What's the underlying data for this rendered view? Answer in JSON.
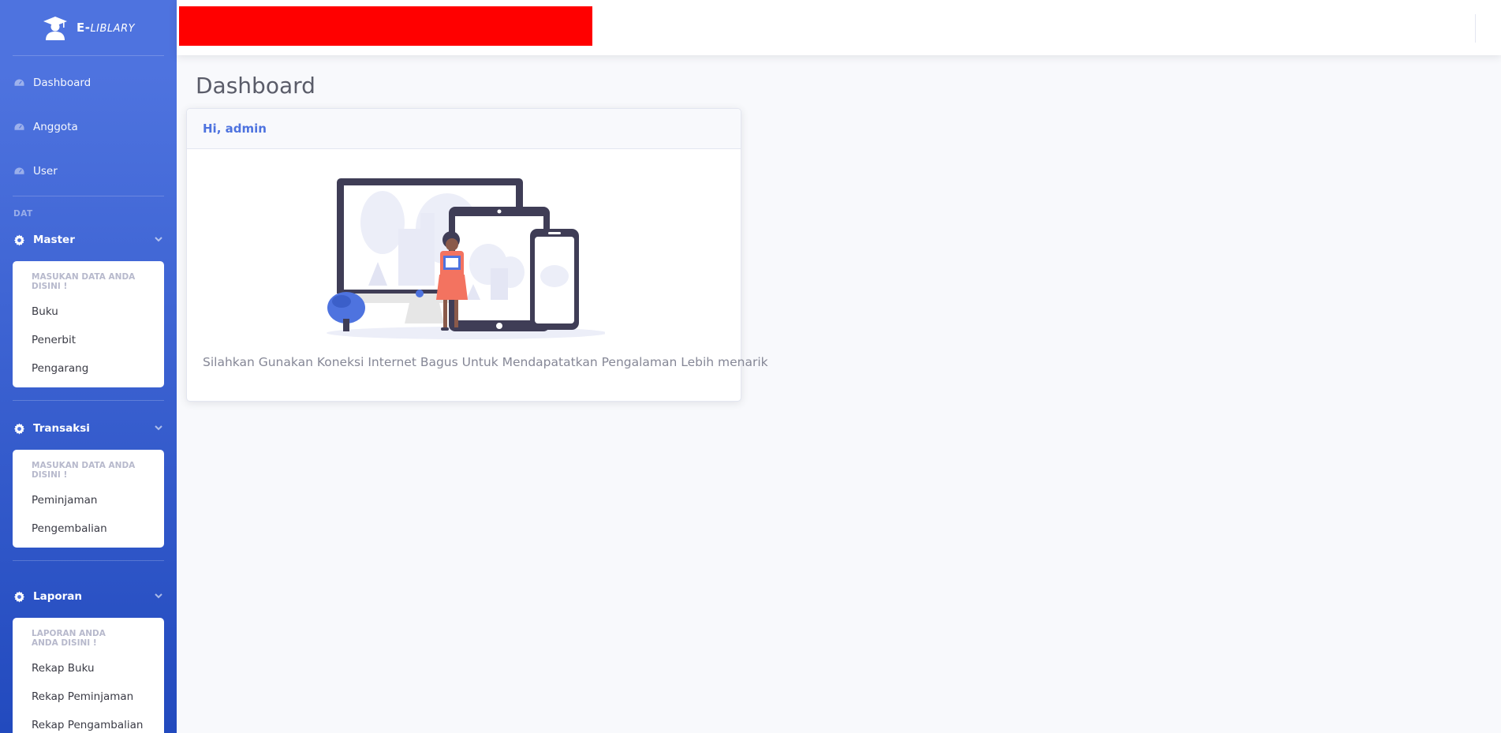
{
  "brand": {
    "prefix": "E-",
    "suffix": "LIBLARY"
  },
  "sidebar": {
    "nav": [
      {
        "label": "Dashboard",
        "icon": "tachometer-icon"
      },
      {
        "label": "Anggota",
        "icon": "tachometer-icon"
      },
      {
        "label": "User",
        "icon": "tachometer-icon"
      }
    ],
    "heading": "DAT",
    "groups": [
      {
        "label": "Master",
        "header": "MASUKAN DATA ANDA DISINI !",
        "items": [
          "Buku",
          "Penerbit",
          "Pengarang"
        ]
      },
      {
        "label": "Transaksi",
        "header": "MASUKAN DATA ANDA DISINI !",
        "items": [
          "Peminjaman",
          "Pengembalian"
        ]
      },
      {
        "label": "Laporan",
        "header_line1": "LAPORAN ANDA",
        "header_line2": "ANDA DISINI !",
        "items": [
          "Rekap Buku",
          "Rekap Peminjaman",
          "Rekap Pengambalian"
        ]
      }
    ]
  },
  "main": {
    "title": "Dashboard",
    "card": {
      "greeting": "Hi, admin",
      "message": "Silahkan Gunakan Koneksi Internet Bagus Untuk Mendapatatkan Pengalaman Lebih menarik"
    }
  },
  "colors": {
    "primary": "#4e73df",
    "sidebar_bottom": "#224abe",
    "redaction": "#ff0000",
    "illustration_coral": "#f37360",
    "illustration_dark": "#3f3d56"
  }
}
